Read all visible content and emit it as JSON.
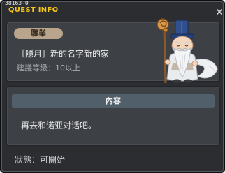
{
  "window": {
    "quest_id": "38163-0",
    "title": "QUEST INFO",
    "title_color": "#f5c51a"
  },
  "quest": {
    "job_label": "職業",
    "name": "［隱月］新的名字新的家",
    "level_req": "建議等級：10以上",
    "npc_sprite": "elderly-sage-npc"
  },
  "content": {
    "header": "內容",
    "text": "再去和诺亚对话吧。"
  },
  "status": {
    "text": "狀態：可開始"
  },
  "colors": {
    "background": "#2b2d31",
    "panel": "#3d4045",
    "content_header": "#515f6a",
    "job_pill": "#b8a58c"
  }
}
